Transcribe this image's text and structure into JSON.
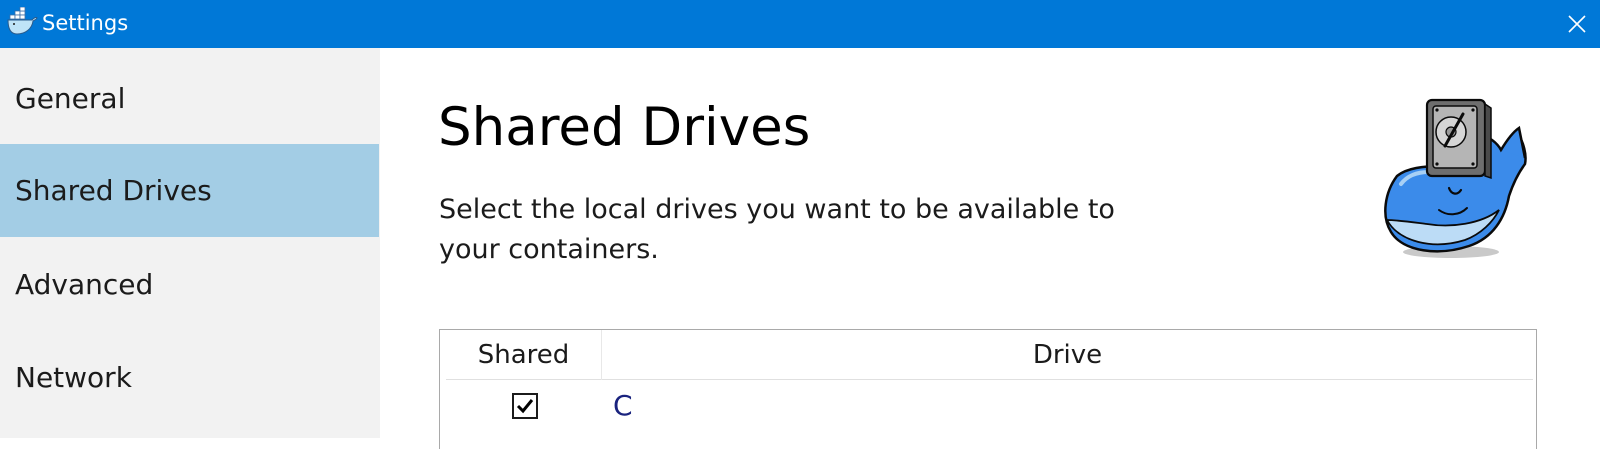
{
  "window": {
    "title": "Settings",
    "app_icon": "docker-whale-icon",
    "close_icon": "close-icon",
    "titlebar_color": "#0078d7"
  },
  "sidebar": {
    "items": [
      {
        "label": "General",
        "selected": false
      },
      {
        "label": "Shared Drives",
        "selected": true
      },
      {
        "label": "Advanced",
        "selected": false
      },
      {
        "label": "Network",
        "selected": false
      }
    ],
    "selected_color": "#a3cde5"
  },
  "main": {
    "title": "Shared Drives",
    "description": "Select the local drives you want to be available to your containers.",
    "illustration": "docker-whale-with-hard-drive",
    "table": {
      "columns": [
        "Shared",
        "Drive"
      ],
      "rows": [
        {
          "shared": true,
          "drive": "C"
        }
      ]
    }
  }
}
